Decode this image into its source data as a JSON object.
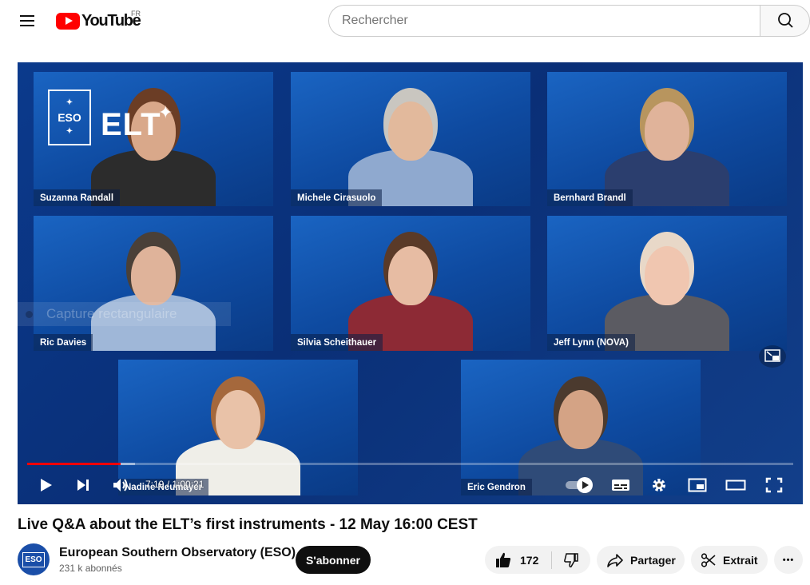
{
  "masthead": {
    "logo_text": "YouTube",
    "country_code": "FR",
    "search_placeholder": "Rechercher",
    "icons": [
      "menu-icon",
      "youtube-logo-icon",
      "search-icon"
    ]
  },
  "player": {
    "tiles": [
      {
        "name": "Suzanna Randall",
        "skin": "#d9a88a",
        "hair": "#6b3d25",
        "shirt": "#2c2c2c"
      },
      {
        "name": "Michele Cirasuolo",
        "skin": "#e2b99c",
        "hair": "#c9c6c0",
        "shirt": "#8fa9cf"
      },
      {
        "name": "Bernhard Brandl",
        "skin": "#e0b39a",
        "hair": "#b8955e",
        "shirt": "#2b3e6e"
      },
      {
        "name": "Ric Davies",
        "skin": "#dfb39a",
        "hair": "#4a4038",
        "shirt": "#9fb7d8"
      },
      {
        "name": "Silvia Scheithauer",
        "skin": "#e7bca3",
        "hair": "#5a3a28",
        "shirt": "#8d2a35"
      },
      {
        "name": "Jeff Lynn (NOVA)",
        "skin": "#f0c6b0",
        "hair": "#e8d8c8",
        "shirt": "#5b5b62"
      },
      {
        "name": "Nadine Neumayer",
        "skin": "#e9c2a8",
        "hair": "#a5683c",
        "shirt": "#efeee8"
      },
      {
        "name": "Eric Gendron",
        "skin": "#d4a385",
        "hair": "#4b3a2e",
        "shirt": "#2f4b78"
      }
    ],
    "eso_logo_text": "ESO",
    "elt_logo_text": "ELT",
    "capture_overlay": "Capture rectangulaire",
    "progress": {
      "played_fraction": 0.1218,
      "loaded_fraction": 0.1408
    },
    "time_display": "7:19 / 1:00:21",
    "controls": [
      "play-icon",
      "next-icon",
      "volume-icon",
      "autoplay-toggle",
      "subtitles-icon",
      "settings-gear-icon",
      "miniplayer-icon",
      "theater-mode-icon",
      "fullscreen-icon"
    ]
  },
  "video": {
    "title": "Live Q&A about the ELT’s first instruments - 12 May 16:00 CEST"
  },
  "channel": {
    "name": "European Southern Observatory (ESO)",
    "subscribers": "231 k abonnés",
    "avatar_text": "ESO",
    "subscribe_label": "S'abonner"
  },
  "actions": {
    "like_count": "172",
    "share_label": "Partager",
    "clip_label": "Extrait",
    "more_label": "•••"
  }
}
